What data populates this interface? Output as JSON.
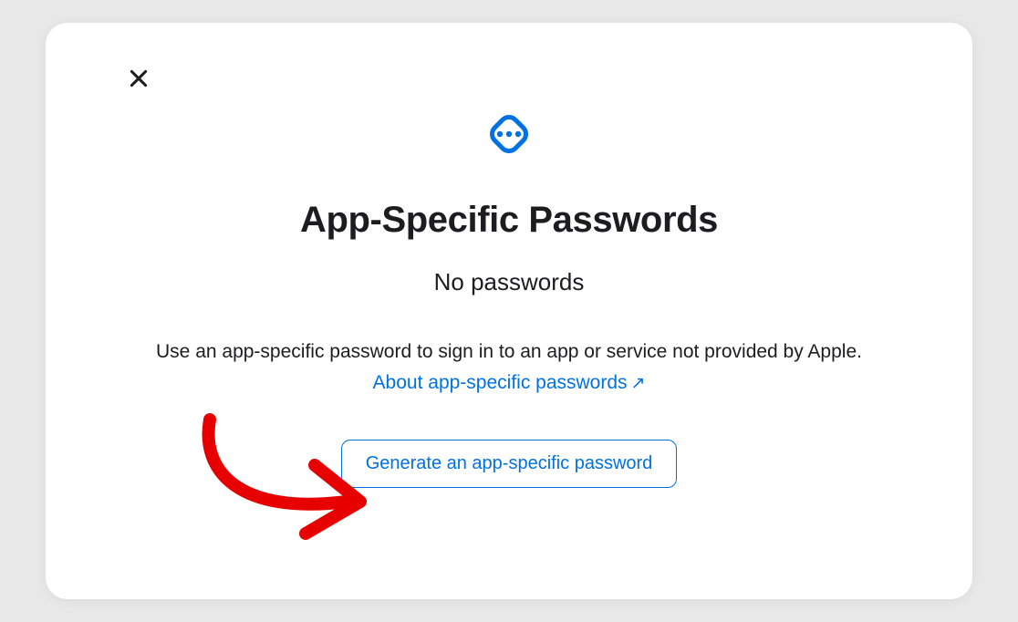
{
  "modal": {
    "title": "App-Specific Passwords",
    "subtitle": "No passwords",
    "description": "Use an app-specific password to sign in to an app or service not provided by Apple.",
    "link_text": "About app-specific passwords",
    "link_arrow": "↗",
    "button_label": "Generate an app-specific password"
  }
}
